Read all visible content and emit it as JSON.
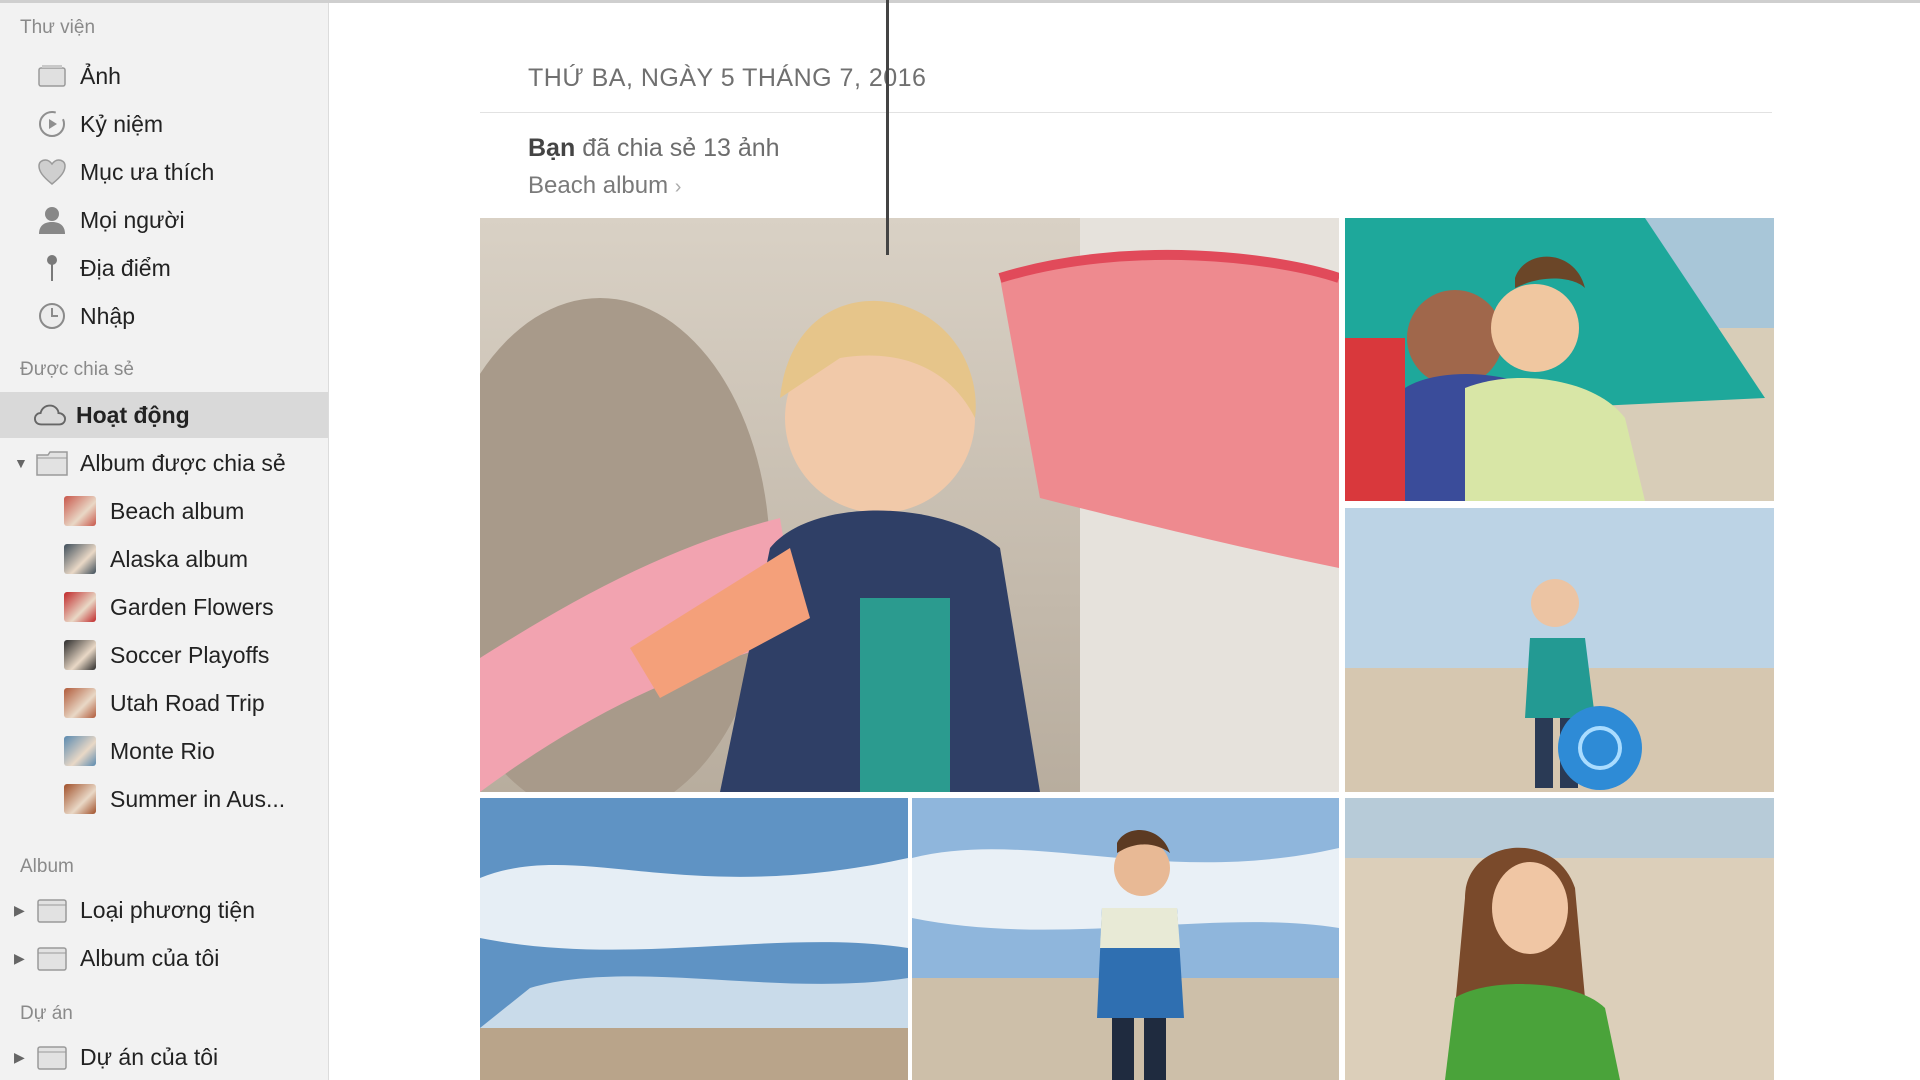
{
  "sidebar": {
    "library_title": "Thư viện",
    "library_items": [
      {
        "label": "Ảnh",
        "icon": "photos-icon"
      },
      {
        "label": "Kỷ niệm",
        "icon": "memories-icon"
      },
      {
        "label": "Mục ưa thích",
        "icon": "heart-icon"
      },
      {
        "label": "Mọi người",
        "icon": "person-icon"
      },
      {
        "label": "Địa điểm",
        "icon": "pin-icon"
      },
      {
        "label": "Nhập",
        "icon": "clock-icon"
      }
    ],
    "shared_title": "Được chia sẻ",
    "activity_label": "Hoạt động",
    "shared_albums_label": "Album được chia sẻ",
    "shared_albums": [
      {
        "label": "Beach album",
        "color": "#c8564a"
      },
      {
        "label": "Alaska album",
        "color": "#3e4e5a"
      },
      {
        "label": "Garden Flowers",
        "color": "#c0282a"
      },
      {
        "label": "Soccer Playoffs",
        "color": "#2b2b2b"
      },
      {
        "label": "Utah Road Trip",
        "color": "#b05a3a"
      },
      {
        "label": "Monte Rio",
        "color": "#5a8ab0"
      },
      {
        "label": "Summer in Aus...",
        "color": "#a0502a"
      }
    ],
    "album_title": "Album",
    "album_items": [
      {
        "label": "Loại phương tiện"
      },
      {
        "label": "Album của tôi"
      }
    ],
    "projects_title": "Dự án",
    "project_items": [
      {
        "label": "Dự án của tôi"
      }
    ]
  },
  "main": {
    "date": "THỨ BA, NGÀY 5 THÁNG 7, 2016",
    "shared_by": "Bạn",
    "shared_text": "đã chia sẻ 13 ảnh",
    "album_link": "Beach album"
  },
  "colors": {
    "sidebar_bg": "#f2f2f2",
    "selected_bg": "#d9d9d9",
    "text_muted": "#8a8a8a"
  }
}
